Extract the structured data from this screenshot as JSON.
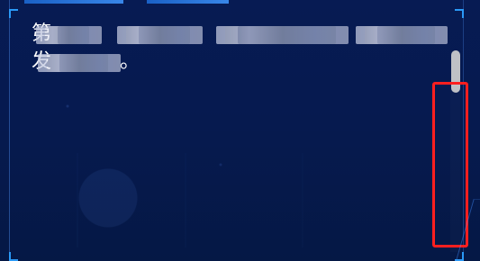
{
  "screen": {
    "colors": {
      "background": "#061a4f",
      "frame": "#2ca0ff",
      "scrollbar": "#bfc1c6",
      "highlight": "#ff1f1f",
      "text": "#ffffff"
    }
  },
  "content": {
    "lines": [
      "第",
      "发"
    ],
    "suffix": "。"
  },
  "controls": {
    "scrollbar": {
      "value": 0
    }
  }
}
